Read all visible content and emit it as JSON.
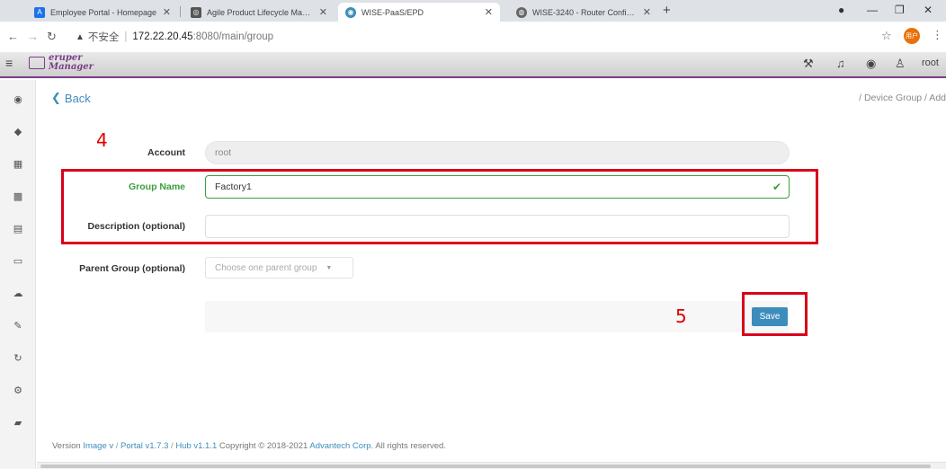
{
  "browser": {
    "tabs": [
      {
        "title": "Employee Portal - Homepage",
        "icon": "portal-icon",
        "color": "#1a73e8",
        "glyph": "A"
      },
      {
        "title": "Agile Product Lifecycle Manag",
        "icon": "agile-icon",
        "color": "#555555",
        "glyph": "◎"
      },
      {
        "title": "WISE-PaaS/EPD",
        "icon": "wise-icon",
        "color": "#3c8dbc",
        "glyph": "◉"
      },
      {
        "title": "WISE-3240 - Router Configura",
        "icon": "router-icon",
        "color": "#666666",
        "glyph": "◍"
      }
    ],
    "close_glyph": "✕",
    "new_tab_glyph": "+",
    "address": {
      "warning_glyph": "▲",
      "insecure_label": "不安全",
      "separator": "|",
      "host": "172.22.20.45",
      "path": ":8080/main/group"
    },
    "profile_label": "用户"
  },
  "header": {
    "menu_glyph": "≡",
    "logo_line1": "eruper",
    "logo_line2": "Manager",
    "user_label": "root"
  },
  "page": {
    "back_label": "Back",
    "back_glyph": "❮",
    "breadcrumb": "/ Device Group / Add"
  },
  "form": {
    "account_label": "Account",
    "account_value": "root",
    "group_name_label": "Group Name",
    "group_name_value": "Factory1",
    "description_label": "Description (optional)",
    "description_value": "",
    "parent_group_label": "Parent Group (optional)",
    "parent_group_placeholder": "Choose one parent group",
    "save_label": "Save"
  },
  "annotations": {
    "step4": "4",
    "step5": "5",
    "color": "#d9001b"
  },
  "footer": {
    "prefix": "Version ",
    "image_link": "Image v",
    "sep1": " / ",
    "portal_link": "Portal v1.7.3",
    "sep2": " / ",
    "hub_link": "Hub v1.1.1",
    "copyright": " Copyright © 2018-2021 ",
    "company_link": "Advantech Corp.",
    "rights": " All rights reserved."
  },
  "colors": {
    "accent": "#3c8dbc",
    "brand": "#7a3d86",
    "valid": "#3c9e3c"
  }
}
